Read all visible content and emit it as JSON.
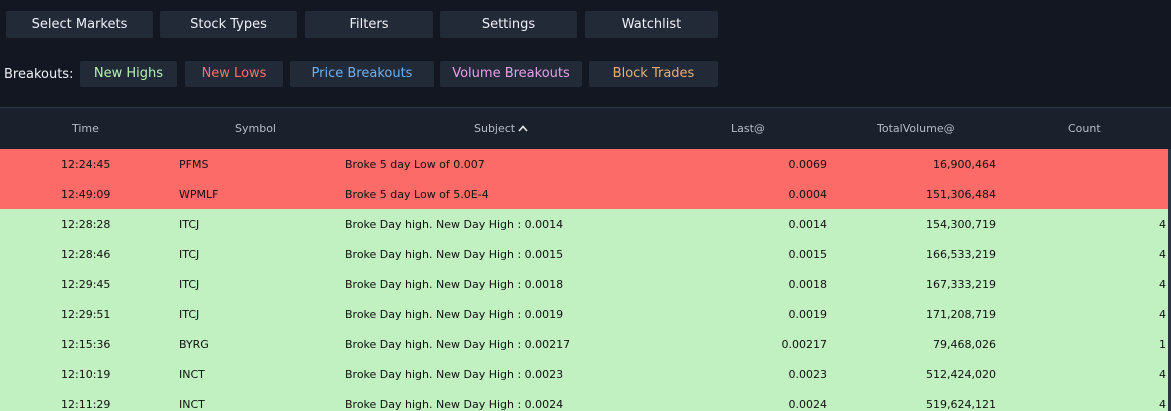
{
  "toolbar": {
    "buttons": [
      "Select Markets",
      "Stock Types",
      "Filters",
      "Settings",
      "Watchlist"
    ]
  },
  "breakouts": {
    "label": "Breakouts:",
    "buttons": [
      {
        "label": "New Highs",
        "color": "#b8f0b8"
      },
      {
        "label": "New Lows",
        "color": "#ff6f6a"
      },
      {
        "label": "Price Breakouts",
        "color": "#6fb0f0"
      },
      {
        "label": "Volume Breakouts",
        "color": "#e6a0ea"
      },
      {
        "label": "Block Trades",
        "color": "#e2b07a"
      }
    ]
  },
  "table": {
    "columns": [
      "Time",
      "Symbol",
      "Subject",
      "Last@",
      "TotalVolume@",
      "Count"
    ],
    "sort_column": "Subject",
    "sort_direction": "ascending",
    "row_colors": {
      "low": "#fd6b68",
      "high": "#c1f0c1"
    },
    "rows": [
      {
        "kind": "low",
        "time": "12:24:45",
        "symbol": "PFMS",
        "subject": "Broke 5 day Low of 0.007",
        "last": "0.0069",
        "volume": "16,900,464",
        "count": ""
      },
      {
        "kind": "low",
        "time": "12:49:09",
        "symbol": "WPMLF",
        "subject": "Broke 5 day Low of 5.0E-4",
        "last": "0.0004",
        "volume": "151,306,484",
        "count": ""
      },
      {
        "kind": "high",
        "time": "12:28:28",
        "symbol": "ITCJ",
        "subject": "Broke Day high. New Day High : 0.0014",
        "last": "0.0014",
        "volume": "154,300,719",
        "count": "4"
      },
      {
        "kind": "high",
        "time": "12:28:46",
        "symbol": "ITCJ",
        "subject": "Broke Day high. New Day High : 0.0015",
        "last": "0.0015",
        "volume": "166,533,219",
        "count": "4"
      },
      {
        "kind": "high",
        "time": "12:29:45",
        "symbol": "ITCJ",
        "subject": "Broke Day high. New Day High : 0.0018",
        "last": "0.0018",
        "volume": "167,333,219",
        "count": "4"
      },
      {
        "kind": "high",
        "time": "12:29:51",
        "symbol": "ITCJ",
        "subject": "Broke Day high. New Day High : 0.0019",
        "last": "0.0019",
        "volume": "171,208,719",
        "count": "4"
      },
      {
        "kind": "high",
        "time": "12:15:36",
        "symbol": "BYRG",
        "subject": "Broke Day high. New Day High : 0.00217",
        "last": "0.00217",
        "volume": "79,468,026",
        "count": "1"
      },
      {
        "kind": "high",
        "time": "12:10:19",
        "symbol": "INCT",
        "subject": "Broke Day high. New Day High : 0.0023",
        "last": "0.0023",
        "volume": "512,424,020",
        "count": "4"
      },
      {
        "kind": "high",
        "time": "12:11:29",
        "symbol": "INCT",
        "subject": "Broke Day high. New Day High : 0.0024",
        "last": "0.0024",
        "volume": "519,624,121",
        "count": "4"
      }
    ]
  }
}
